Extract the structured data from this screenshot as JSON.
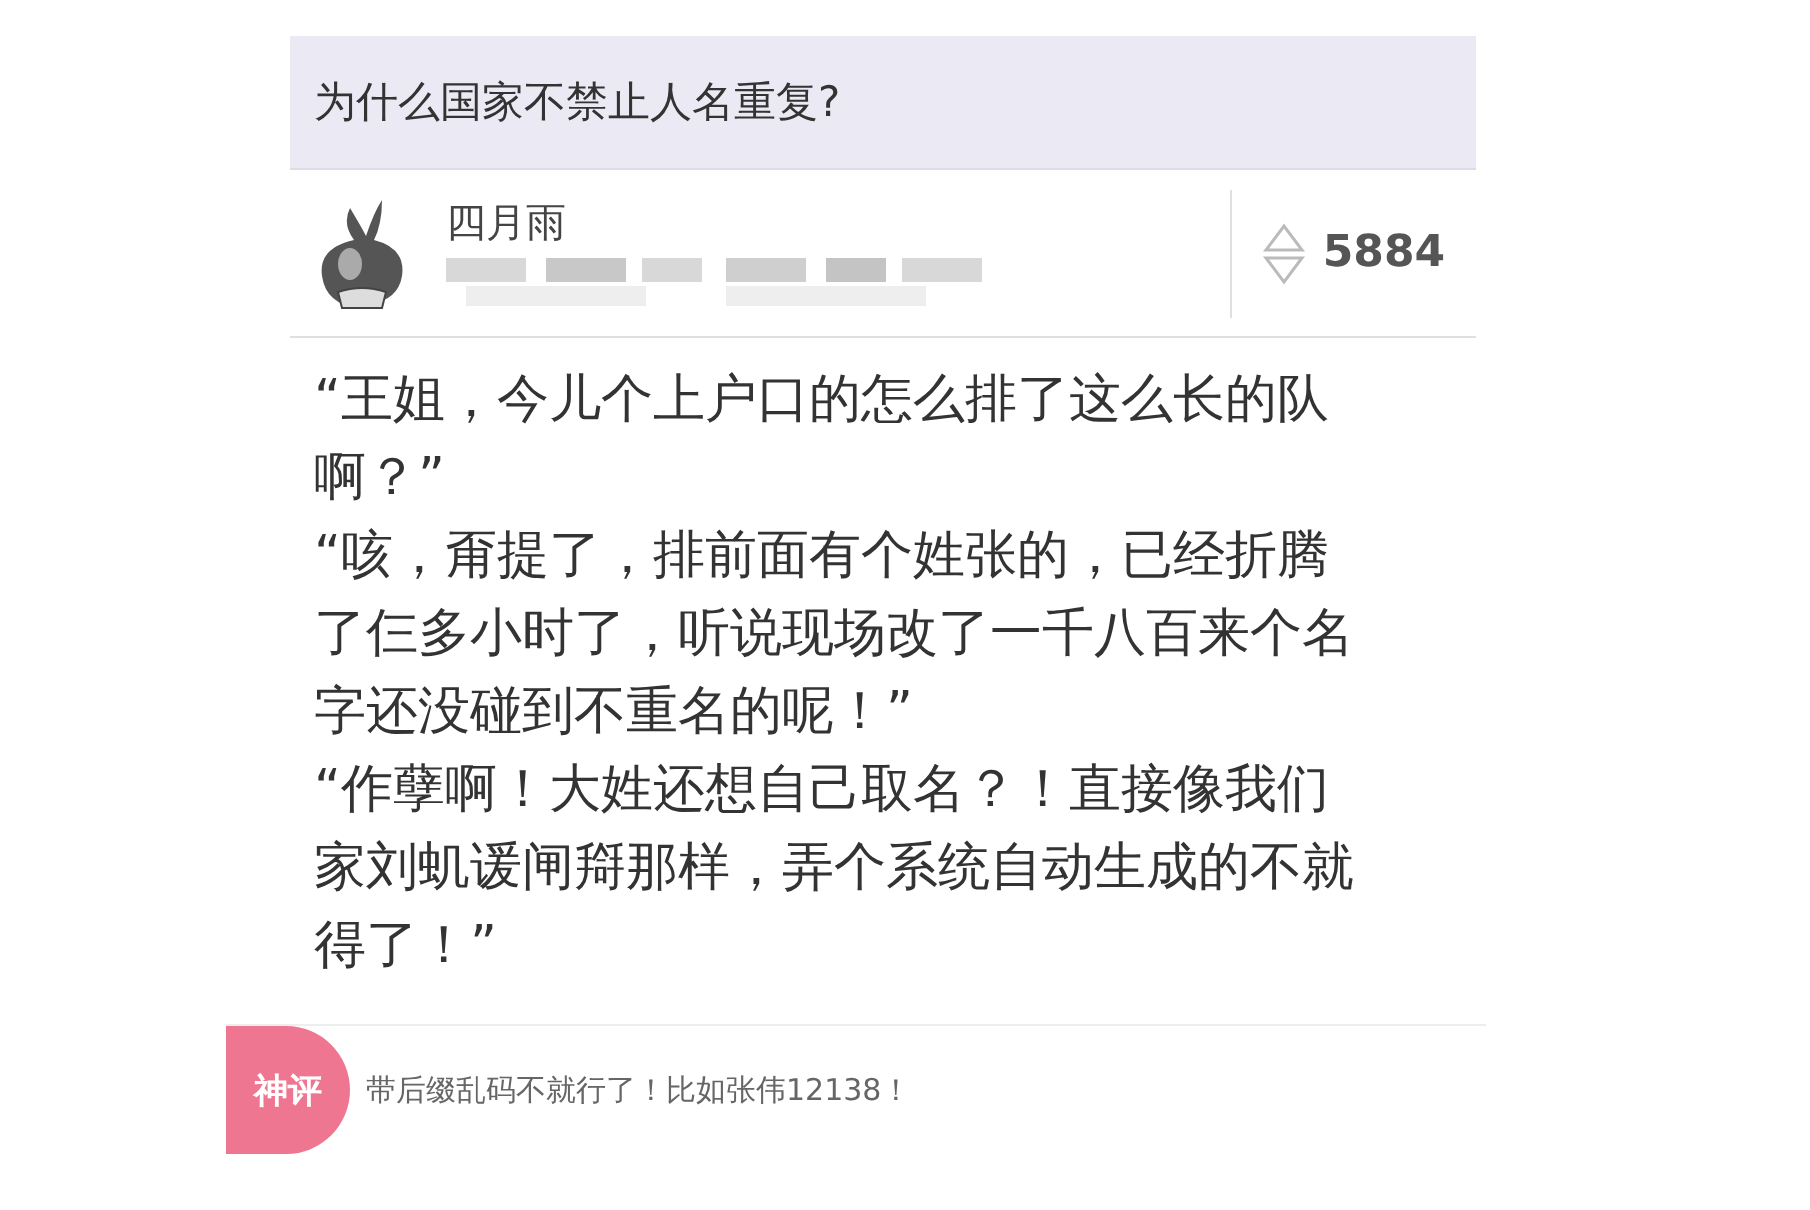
{
  "question": {
    "title": "为什么国家不禁止人名重复?"
  },
  "answer": {
    "author": "四月雨",
    "votes": "5884",
    "paragraphs": [
      "“王姐，今儿个上户口的怎么排了这么长的队啊？”",
      "“咳，甭提了，排前面有个姓张的，已经折腾了仨多小时了，听说现场改了一千八百来个名字还没碰到不重名的呢！”",
      "“作孽啊！大姓还想自己取名？！直接像我们家刘虮谖闸搿那样，弄个系统自动生成的不就得了！”"
    ]
  },
  "top_comment": {
    "badge": "神评",
    "text": "带后缀乱码不就行了！比如张伟12138！"
  }
}
